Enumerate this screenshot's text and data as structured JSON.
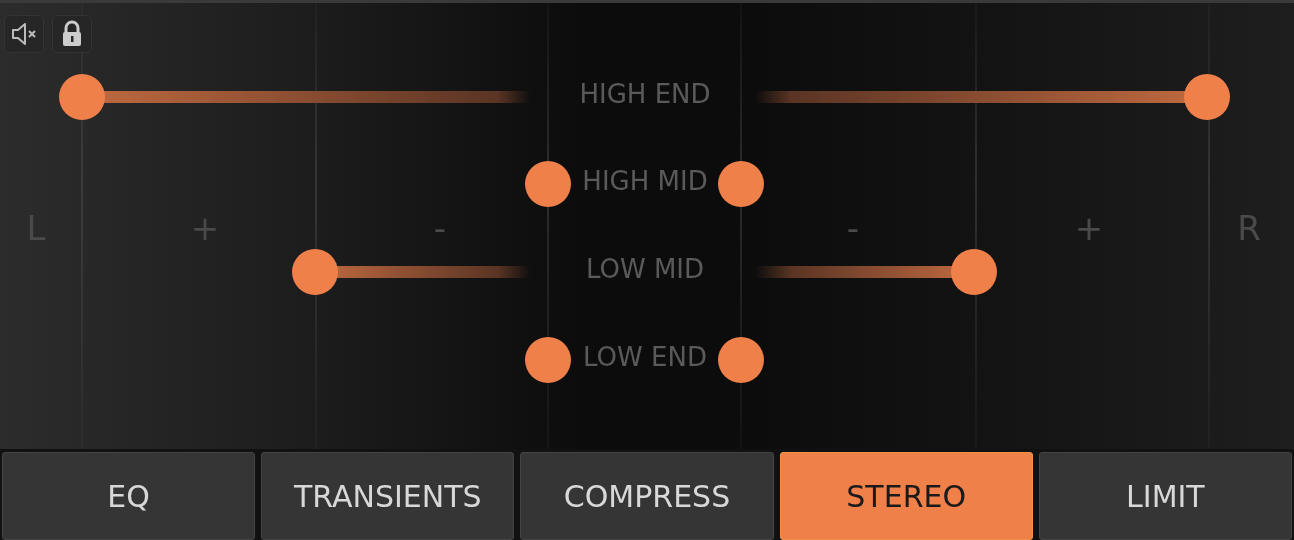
{
  "toolbar": {
    "mute_button": {
      "muted": true
    },
    "lock_button": {
      "locked": true
    }
  },
  "scale": [
    "L",
    "+",
    "-",
    "-",
    "+",
    "R"
  ],
  "bands": [
    {
      "label": "HIGH END"
    },
    {
      "label": "HIGH MID"
    },
    {
      "label": "LOW MID"
    },
    {
      "label": "LOW END"
    }
  ],
  "tabs": [
    {
      "label": "EQ",
      "selected": false
    },
    {
      "label": "TRANSIENTS",
      "selected": false
    },
    {
      "label": "COMPRESS",
      "selected": false
    },
    {
      "label": "STEREO",
      "selected": true
    },
    {
      "label": "LIMIT",
      "selected": false
    }
  ]
}
